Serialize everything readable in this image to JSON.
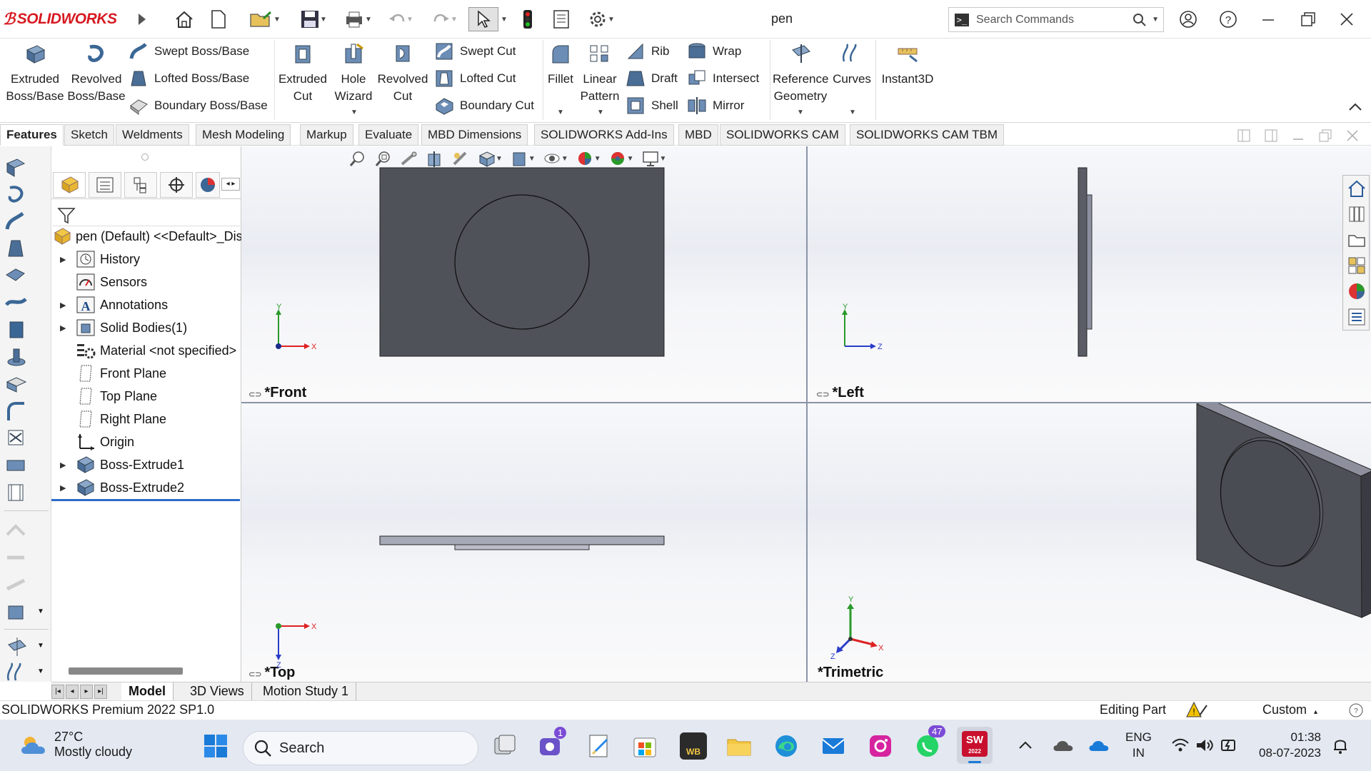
{
  "app": {
    "brand": "SOLIDWORKS",
    "document_title": "pen",
    "search_placeholder": "Search Commands",
    "accent": "#d71921"
  },
  "command_manager": {
    "big_buttons": [
      {
        "label1": "Extruded",
        "label2": "Boss/Base",
        "icon": "extruded-boss-icon"
      },
      {
        "label1": "Revolved",
        "label2": "Boss/Base",
        "icon": "revolved-boss-icon"
      },
      {
        "label1": "Extruded",
        "label2": "Cut",
        "icon": "extruded-cut-icon"
      },
      {
        "label1": "Hole",
        "label2": "Wizard",
        "icon": "hole-wizard-icon"
      },
      {
        "label1": "Revolved",
        "label2": "Cut",
        "icon": "revolved-cut-icon"
      },
      {
        "label1": "Fillet",
        "label2": "",
        "icon": "fillet-icon"
      },
      {
        "label1": "Linear",
        "label2": "Pattern",
        "icon": "linear-pattern-icon"
      },
      {
        "label1": "Reference",
        "label2": "Geometry",
        "icon": "reference-geometry-icon"
      },
      {
        "label1": "Curves",
        "label2": "",
        "icon": "curves-icon"
      },
      {
        "label1": "Instant3D",
        "label2": "",
        "icon": "instant3d-icon"
      }
    ],
    "small_buttons": [
      {
        "label": "Swept Boss/Base"
      },
      {
        "label": "Lofted Boss/Base"
      },
      {
        "label": "Boundary Boss/Base"
      },
      {
        "label": "Swept Cut"
      },
      {
        "label": "Lofted Cut"
      },
      {
        "label": "Boundary Cut"
      },
      {
        "label": "Rib"
      },
      {
        "label": "Draft"
      },
      {
        "label": "Shell"
      },
      {
        "label": "Wrap"
      },
      {
        "label": "Intersect"
      },
      {
        "label": "Mirror"
      }
    ]
  },
  "tabs": [
    "Features",
    "Sketch",
    "Weldments",
    "Mesh Modeling",
    "Markup",
    "Evaluate",
    "MBD Dimensions",
    "SOLIDWORKS Add-Ins",
    "MBD",
    "SOLIDWORKS CAM",
    "SOLIDWORKS CAM TBM"
  ],
  "feature_tree": {
    "root": "pen (Default) <<Default>_Dis",
    "items": [
      {
        "label": "History",
        "expandable": true
      },
      {
        "label": "Sensors",
        "expandable": false
      },
      {
        "label": "Annotations",
        "expandable": true
      },
      {
        "label": "Solid Bodies(1)",
        "expandable": true
      },
      {
        "label": "Material <not specified>",
        "expandable": false
      },
      {
        "label": "Front Plane",
        "expandable": false
      },
      {
        "label": "Top Plane",
        "expandable": false
      },
      {
        "label": "Right Plane",
        "expandable": false
      },
      {
        "label": "Origin",
        "expandable": false
      },
      {
        "label": "Boss-Extrude1",
        "expandable": true
      },
      {
        "label": "Boss-Extrude2",
        "expandable": true
      }
    ]
  },
  "viewports": {
    "front": "*Front",
    "left": "*Left",
    "top": "*Top",
    "trimetric": "*Trimetric"
  },
  "axis_labels": {
    "x": "X",
    "y": "Y",
    "z": "Z"
  },
  "bottom_tabs": [
    "Model",
    "3D Views",
    "Motion Study 1"
  ],
  "status": {
    "version": "SOLIDWORKS Premium 2022 SP1.0",
    "mode": "Editing Part",
    "units": "Custom"
  },
  "taskbar": {
    "weather_temp": "27°C",
    "weather_desc": "Mostly cloudy",
    "search": "Search",
    "teams_badge": "1",
    "whatsapp_badge": "47",
    "language1": "ENG",
    "language2": "IN",
    "time": "01:38",
    "date": "08-07-2023",
    "sw_label": "2022",
    "wb_label": "WB"
  }
}
